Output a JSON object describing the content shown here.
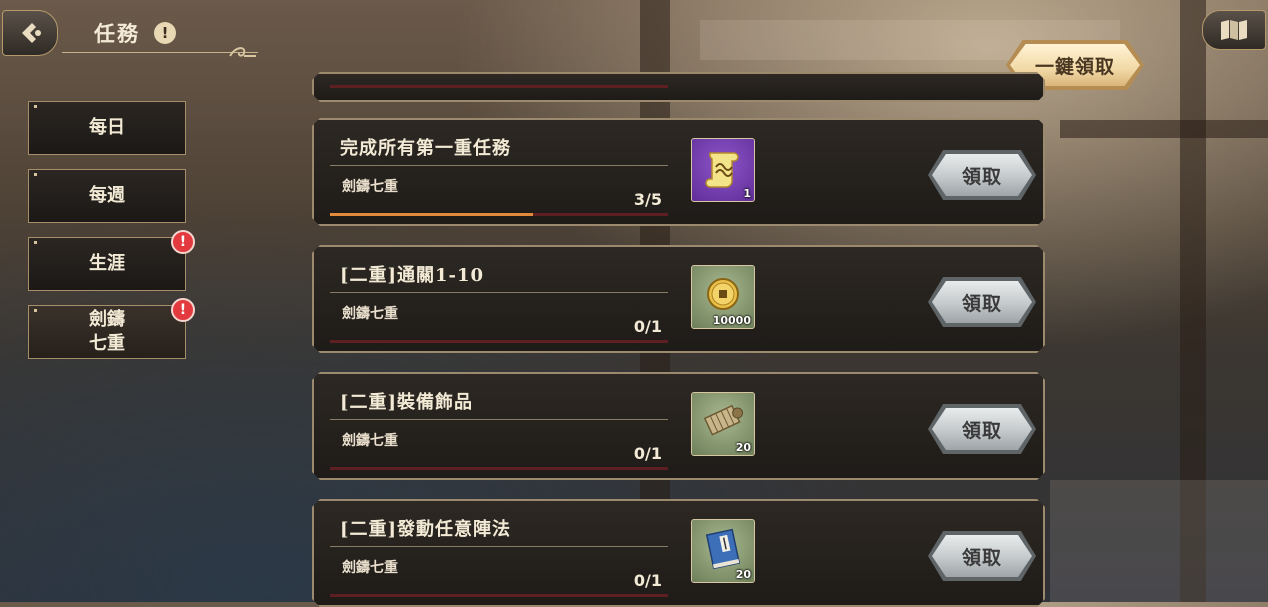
{
  "header": {
    "title": "任務",
    "title_alert": "!",
    "back_icon": "back-arrow-icon",
    "map_icon": "map-icon"
  },
  "sidebar": {
    "items": [
      {
        "label": "每日",
        "alert": false,
        "active": false
      },
      {
        "label": "每週",
        "alert": false,
        "active": false
      },
      {
        "label": "生涯",
        "alert": true,
        "active": false
      },
      {
        "label": "劍鑄\n七重",
        "alert": true,
        "active": true
      }
    ],
    "alert_mark": "!"
  },
  "claim_all_label": "一鍵領取",
  "tasks": [
    {
      "title": "完成所有第一重任務",
      "subtitle": "劍鑄七重",
      "count": "3/5",
      "progress": 0.6,
      "reward": {
        "icon": "scroll-icon",
        "qty": "1",
        "bg": "purple"
      },
      "claim_label": "領取"
    },
    {
      "title": "[二重]通關1-10",
      "subtitle": "劍鑄七重",
      "count": "0/1",
      "progress": 0,
      "reward": {
        "icon": "coin-icon",
        "qty": "10000",
        "bg": "green"
      },
      "claim_label": "領取"
    },
    {
      "title": "[二重]裝備飾品",
      "subtitle": "劍鑄七重",
      "count": "0/1",
      "progress": 0,
      "reward": {
        "icon": "bamboo-scroll-icon",
        "qty": "20",
        "bg": "green"
      },
      "claim_label": "領取"
    },
    {
      "title": "[二重]發動任意陣法",
      "subtitle": "劍鑄七重",
      "count": "0/1",
      "progress": 0,
      "reward": {
        "icon": "book-icon",
        "qty": "20",
        "bg": "green"
      },
      "claim_label": "領取"
    }
  ],
  "colors": {
    "progress_fill": "#e08a3a",
    "progress_track": "#5e1f22",
    "alert_red": "#e23a3f"
  }
}
